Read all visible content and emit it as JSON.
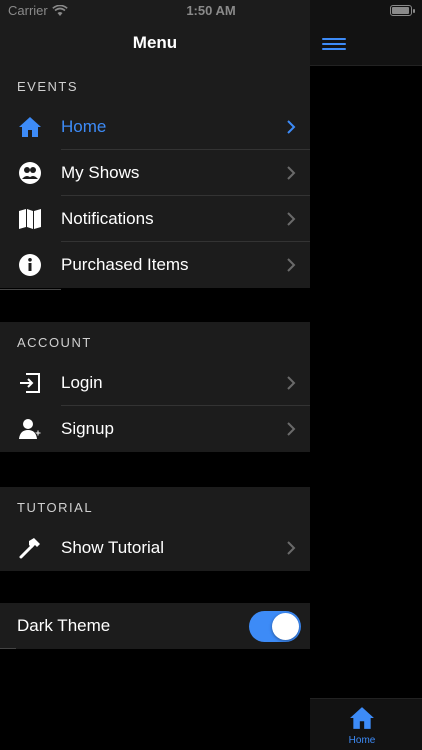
{
  "status_bar": {
    "carrier": "Carrier",
    "time": "1:50 AM"
  },
  "menu": {
    "title": "Menu",
    "sections": [
      {
        "header": "EVENTS",
        "items": [
          {
            "label": "Home",
            "icon": "home-icon",
            "active": true
          },
          {
            "label": "My Shows",
            "icon": "people-icon",
            "active": false
          },
          {
            "label": "Notifications",
            "icon": "map-icon",
            "active": false
          },
          {
            "label": "Purchased Items",
            "icon": "info-icon",
            "active": false
          }
        ]
      },
      {
        "header": "ACCOUNT",
        "items": [
          {
            "label": "Login",
            "icon": "login-icon"
          },
          {
            "label": "Signup",
            "icon": "person-add-icon"
          }
        ]
      },
      {
        "header": "TUTORIAL",
        "items": [
          {
            "label": "Show Tutorial",
            "icon": "hammer-icon"
          }
        ]
      }
    ],
    "dark_theme": {
      "label": "Dark Theme",
      "enabled": true
    }
  },
  "tab_bar": {
    "home_label": "Home"
  },
  "colors": {
    "accent": "#3d8bf7",
    "panel": "#1c1c1c",
    "background": "#000000"
  }
}
